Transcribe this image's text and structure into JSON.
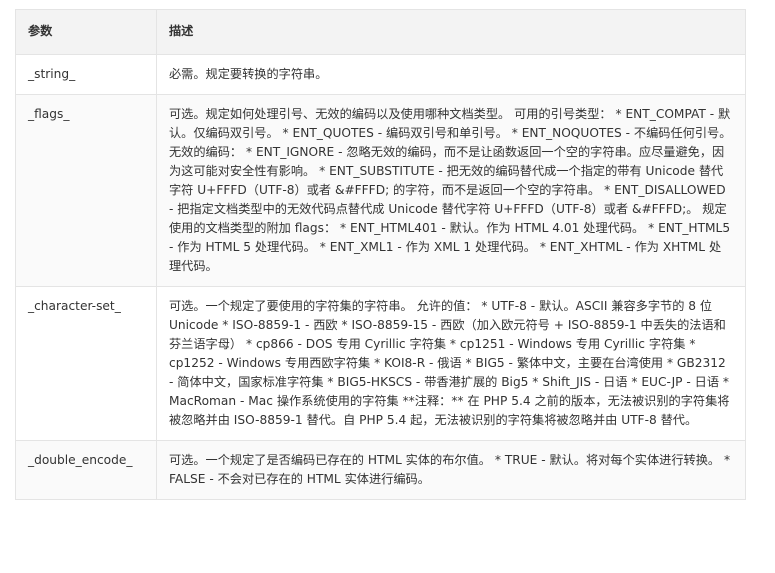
{
  "table": {
    "headers": [
      "参数",
      "描述"
    ],
    "rows": [
      {
        "param": "_string_",
        "desc": "必需。规定要转换的字符串。"
      },
      {
        "param": "_flags_",
        "desc": "可选。规定如何处理引号、无效的编码以及使用哪种文档类型。 可用的引号类型： * ENT_COMPAT - 默认。仅编码双引号。 * ENT_QUOTES - 编码双引号和单引号。 * ENT_NOQUOTES - 不编码任何引号。 无效的编码： * ENT_IGNORE - 忽略无效的编码，而不是让函数返回一个空的字符串。应尽量避免，因为这可能对安全性有影响。 * ENT_SUBSTITUTE - 把无效的编码替代成一个指定的带有 Unicode 替代字符 U+FFFD（UTF-8）或者 &#FFFD; 的字符，而不是返回一个空的字符串。 * ENT_DISALLOWED - 把指定文档类型中的无效代码点替代成 Unicode 替代字符 U+FFFD（UTF-8）或者 &#FFFD;。 规定使用的文档类型的附加 flags： * ENT_HTML401 - 默认。作为 HTML 4.01 处理代码。 * ENT_HTML5 - 作为 HTML 5 处理代码。 * ENT_XML1 - 作为 XML 1 处理代码。 * ENT_XHTML - 作为 XHTML 处理代码。"
      },
      {
        "param": "_character-set_",
        "desc": "可选。一个规定了要使用的字符集的字符串。 允许的值： * UTF-8 - 默认。ASCII 兼容多字节的 8 位 Unicode * ISO-8859-1 - 西欧 * ISO-8859-15 - 西欧（加入欧元符号 + ISO-8859-1 中丢失的法语和芬兰语字母） * cp866 - DOS 专用 Cyrillic 字符集 * cp1251 - Windows 专用 Cyrillic 字符集 * cp1252 - Windows 专用西欧字符集 * KOI8-R - 俄语 * BIG5 - 繁体中文，主要在台湾使用 * GB2312 - 简体中文，国家标准字符集 * BIG5-HKSCS - 带香港扩展的 Big5 * Shift_JIS - 日语 * EUC-JP - 日语 * MacRoman - Mac 操作系统使用的字符集 **注释：** 在 PHP 5.4 之前的版本，无法被识别的字符集将被忽略并由 ISO-8859-1 替代。自 PHP 5.4 起，无法被识别的字符集将被忽略并由 UTF-8 替代。"
      },
      {
        "param": "_double_encode_",
        "desc": "可选。一个规定了是否编码已存在的 HTML 实体的布尔值。 * TRUE - 默认。将对每个实体进行转换。 * FALSE - 不会对已存在的 HTML 实体进行编码。"
      }
    ]
  }
}
